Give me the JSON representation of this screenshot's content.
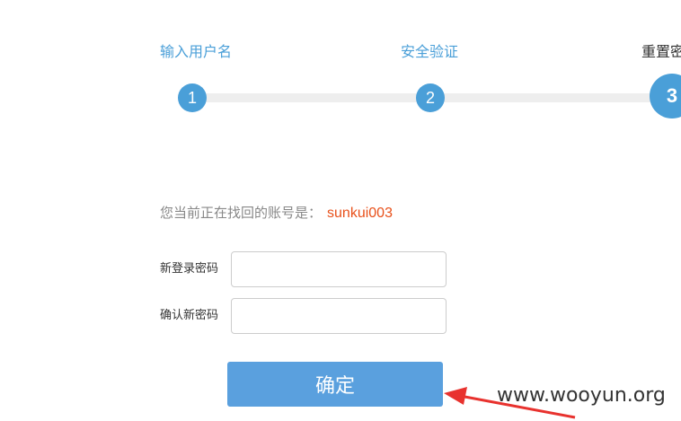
{
  "steps": [
    {
      "label": "输入用户名",
      "number": "1"
    },
    {
      "label": "安全验证",
      "number": "2"
    },
    {
      "label": "重置密",
      "number": "3"
    }
  ],
  "account": {
    "prefix": "您当前正在找回的账号是：",
    "username": "sunkui003"
  },
  "form": {
    "new_password_label": "新登录密码",
    "new_password_value": "",
    "confirm_password_label": "确认新密码",
    "confirm_password_value": ""
  },
  "confirm_button_label": "确定",
  "watermark": {
    "text": "www.wooyun.org",
    "icon": "red-arrow-icon"
  },
  "colors": {
    "accent": "#4a9fd8",
    "button": "#5aa0de",
    "username": "#e8501a",
    "arrow": "#e8322e"
  }
}
